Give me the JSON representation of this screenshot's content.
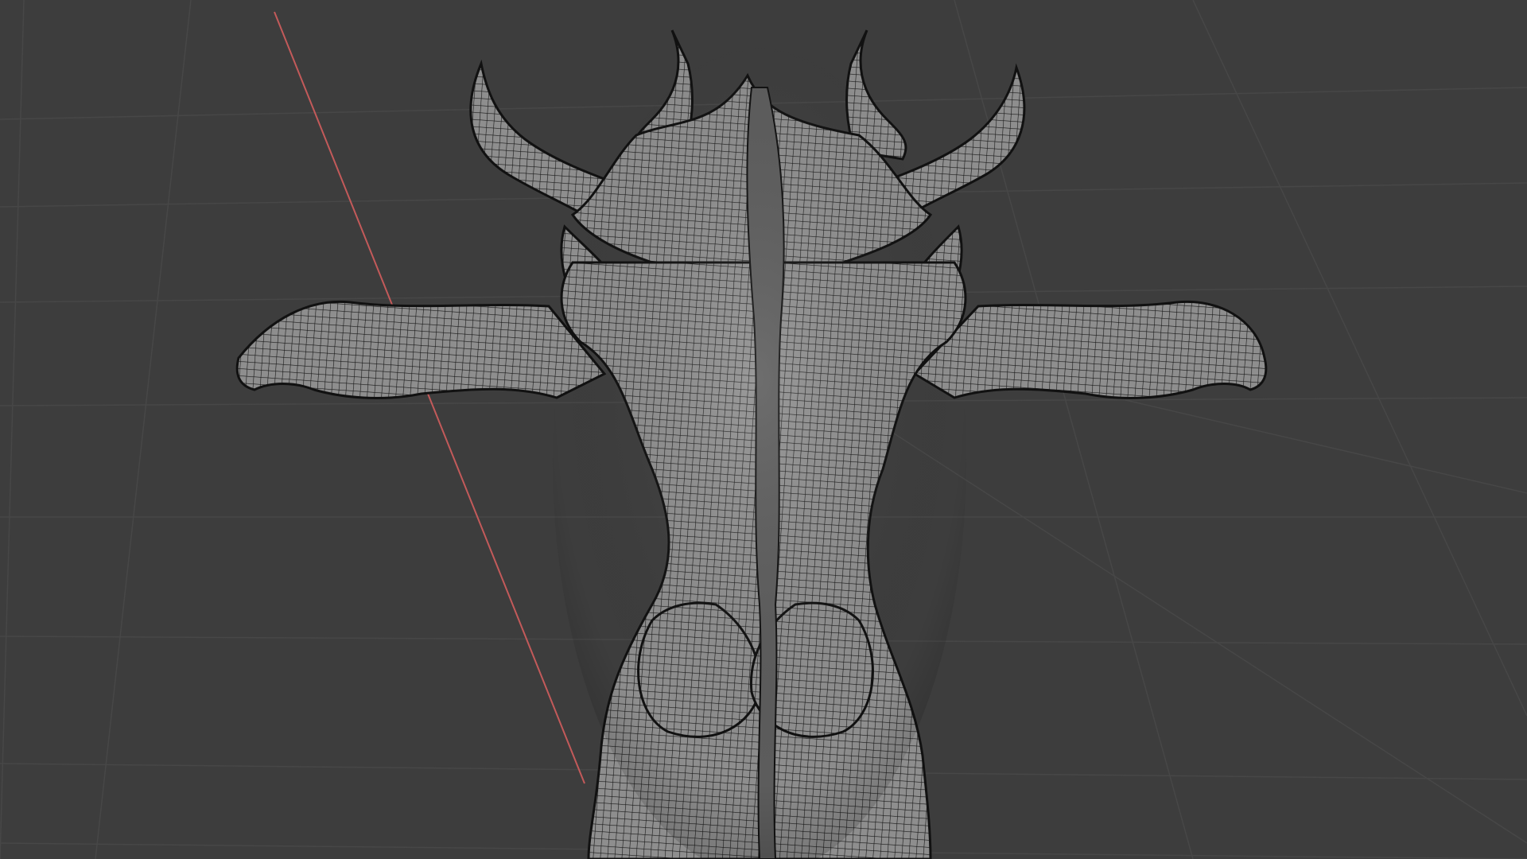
{
  "viewport": {
    "mode": "3D viewport",
    "background_color": "#3d3d3d",
    "grid_color": "#4a4a4a",
    "x_axis_color": "#c35a5a",
    "mesh_fill_color": "#8e8e8e",
    "wire_color": "#171717",
    "shading": "wireframe-overlay",
    "object": "horned-creature-mesh",
    "view": "back"
  }
}
